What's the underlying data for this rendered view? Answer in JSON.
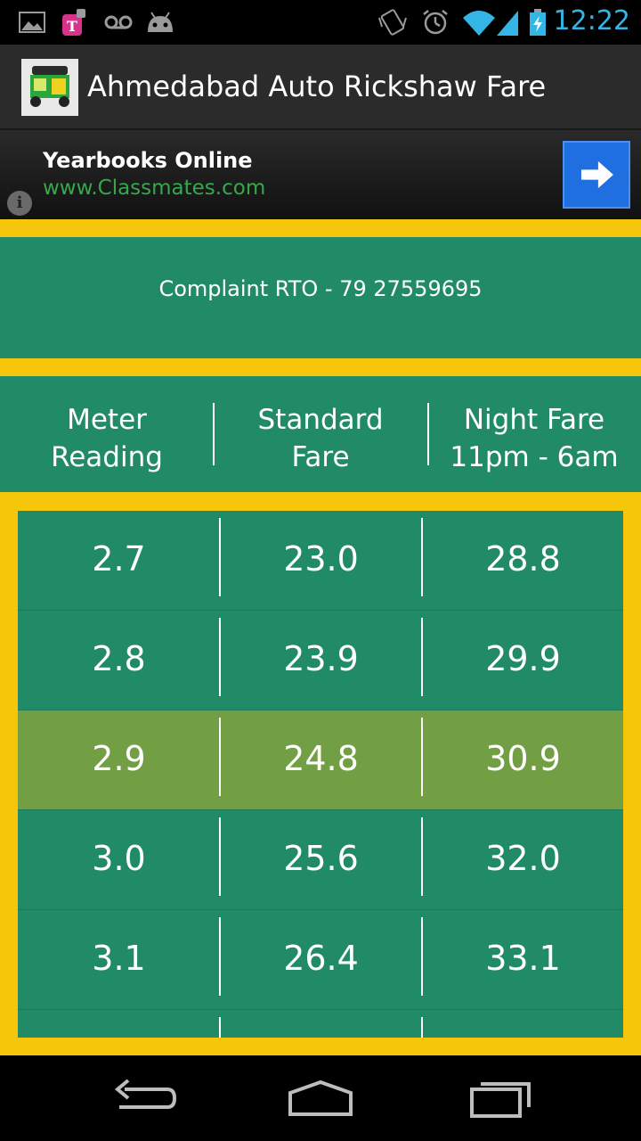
{
  "status_bar": {
    "time": "12:22",
    "icons": [
      "image-icon",
      "t-mobile-icon",
      "voicemail-icon",
      "android-icon",
      "vibrate-icon",
      "alarm-icon",
      "wifi-icon",
      "signal-icon",
      "battery-charging-icon"
    ],
    "accent_color": "#33b5e5"
  },
  "action_bar": {
    "title": "Ahmedabad Auto Rickshaw Fare",
    "icon": "auto-rickshaw-icon"
  },
  "ad": {
    "title": "Yearbooks Online",
    "url": "www.Classmates.com",
    "info_glyph": "i"
  },
  "complaint": {
    "text": "Complaint RTO - 79 27559695"
  },
  "table": {
    "headers": [
      {
        "line1": "Meter",
        "line2": "Reading"
      },
      {
        "line1": "Standard",
        "line2": "Fare"
      },
      {
        "line1": "Night Fare",
        "line2": "11pm - 6am"
      }
    ],
    "rows": [
      {
        "meter": "2.7",
        "standard": "23.0",
        "night": "28.8",
        "highlighted": false
      },
      {
        "meter": "2.8",
        "standard": "23.9",
        "night": "29.9",
        "highlighted": false
      },
      {
        "meter": "2.9",
        "standard": "24.8",
        "night": "30.9",
        "highlighted": true
      },
      {
        "meter": "3.0",
        "standard": "25.6",
        "night": "32.0",
        "highlighted": false
      },
      {
        "meter": "3.1",
        "standard": "26.4",
        "night": "33.1",
        "highlighted": false
      },
      {
        "meter": "",
        "standard": "",
        "night": "",
        "highlighted": false
      }
    ]
  },
  "colors": {
    "green": "#218b67",
    "highlight": "#739f44",
    "yellow": "#f5c60a"
  },
  "nav_bar": {
    "icons": [
      "back-icon",
      "home-icon",
      "recent-apps-icon"
    ]
  }
}
